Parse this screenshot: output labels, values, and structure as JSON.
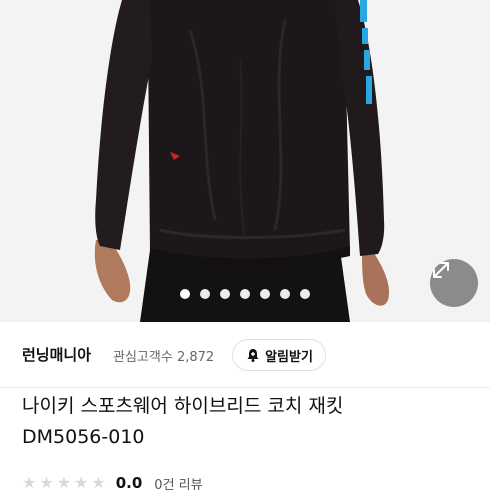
{
  "product_image": {
    "carousel_dot_count": 7,
    "active_dot_index": 0,
    "expand_icon": "expand-diagonal-icon"
  },
  "seller": {
    "name": "런닝매니아",
    "interest_label": "관심고객수",
    "interest_count": "2,872",
    "alarm_button_label": "알림받기",
    "alarm_icon": "bell-plus-icon"
  },
  "product": {
    "title_line1": "나이키 스포츠웨어 하이브리드 코치 재킷",
    "title_line2": "DM5056-010"
  },
  "rating": {
    "stars_total": 5,
    "value": "0.0",
    "review_count_label": "0건 리뷰"
  },
  "colors": {
    "jacket": "#1c1719",
    "sleeve_accent": "#2aa6e0",
    "logo_accent": "#d0202a",
    "expand_button_bg": "#787878"
  }
}
